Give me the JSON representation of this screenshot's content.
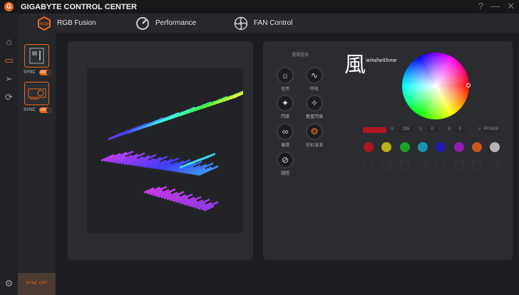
{
  "app": {
    "title": "GIGABYTE CONTROL CENTER",
    "logo": "G"
  },
  "window": {
    "help": "?",
    "minimize": "—",
    "close": "✕"
  },
  "nav": [
    {
      "label": "RGB Fusion",
      "icon": "rgb-icon"
    },
    {
      "label": "Performance",
      "icon": "gauge-icon"
    },
    {
      "label": "FAN Control",
      "icon": "fan-icon"
    }
  ],
  "devices": [
    {
      "sync_label": "SYNC",
      "toggle": "ON"
    },
    {
      "sync_label": "SYNC",
      "toggle": "ON"
    }
  ],
  "sync_off": "SYNC OFF",
  "effects": {
    "header": "選擇燈效",
    "items": [
      {
        "label": "恆亮",
        "glyph": "☼"
      },
      {
        "label": "呼吸",
        "glyph": "∿"
      },
      {
        "label": "閃爍",
        "glyph": "✦"
      },
      {
        "label": "雙重閃爍",
        "glyph": "✧"
      },
      {
        "label": "循環",
        "glyph": "∞"
      },
      {
        "label": "彩虹波浪",
        "glyph": "❂"
      },
      {
        "label": "關閉",
        "glyph": "⊘"
      }
    ]
  },
  "watermark": {
    "char": "風",
    "text": "windwithme"
  },
  "color": {
    "current": "#b0161b",
    "r_label": "R",
    "r": "255",
    "g_label": "G",
    "g": "0",
    "b_label": "B",
    "b": "0",
    "hex_label": "#",
    "hex": "FF0000",
    "presets": [
      "#b0161b",
      "#b8b21c",
      "#1fa127",
      "#1c93b2",
      "#1a1ab0",
      "#8e1cb0",
      "#c9581c",
      "#b5b5b5"
    ]
  }
}
